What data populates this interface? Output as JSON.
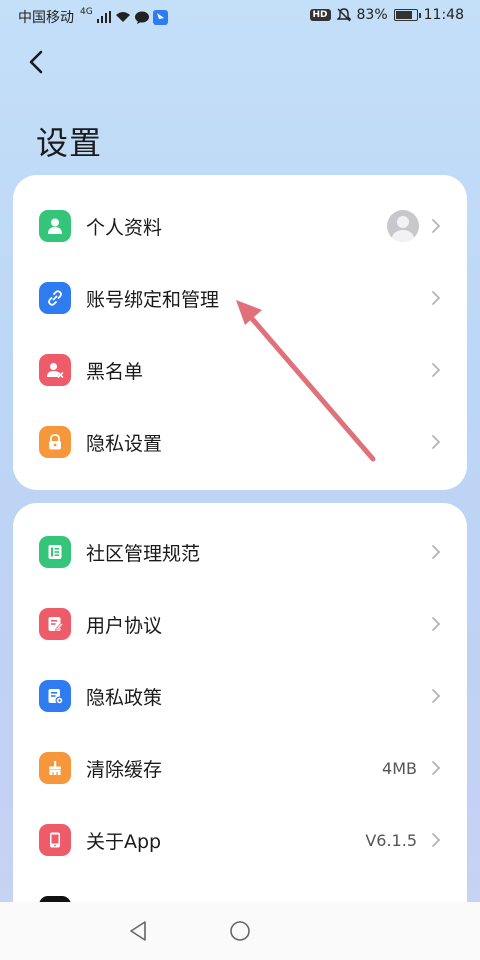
{
  "status_bar": {
    "carrier": "中国移动",
    "network": "4G",
    "hd": "HD",
    "battery": "83%",
    "time": "11:48"
  },
  "header": {
    "title": "设置"
  },
  "group1": [
    {
      "label": "个人资料",
      "icon": "person-icon",
      "color": "#35c57a"
    },
    {
      "label": "账号绑定和管理",
      "icon": "link-icon",
      "color": "#2f7cf0"
    },
    {
      "label": "黑名单",
      "icon": "blocked-user-icon",
      "color": "#ee5c6a"
    },
    {
      "label": "隐私设置",
      "icon": "lock-icon",
      "color": "#f5973a"
    }
  ],
  "group2": [
    {
      "label": "社区管理规范",
      "icon": "rules-icon",
      "color": "#35c57a",
      "value": ""
    },
    {
      "label": "用户协议",
      "icon": "agreement-icon",
      "color": "#ee5c6a",
      "value": ""
    },
    {
      "label": "隐私政策",
      "icon": "policy-icon",
      "color": "#2f7cf0",
      "value": ""
    },
    {
      "label": "清除缓存",
      "icon": "clean-icon",
      "color": "#f5973a",
      "value": "4MB"
    },
    {
      "label": "关于App",
      "icon": "about-icon",
      "color": "#ee5c6a",
      "value": "V6.1.5"
    }
  ],
  "colors": {
    "annotation_arrow": "#e0707a",
    "background": "#c4dff8"
  }
}
